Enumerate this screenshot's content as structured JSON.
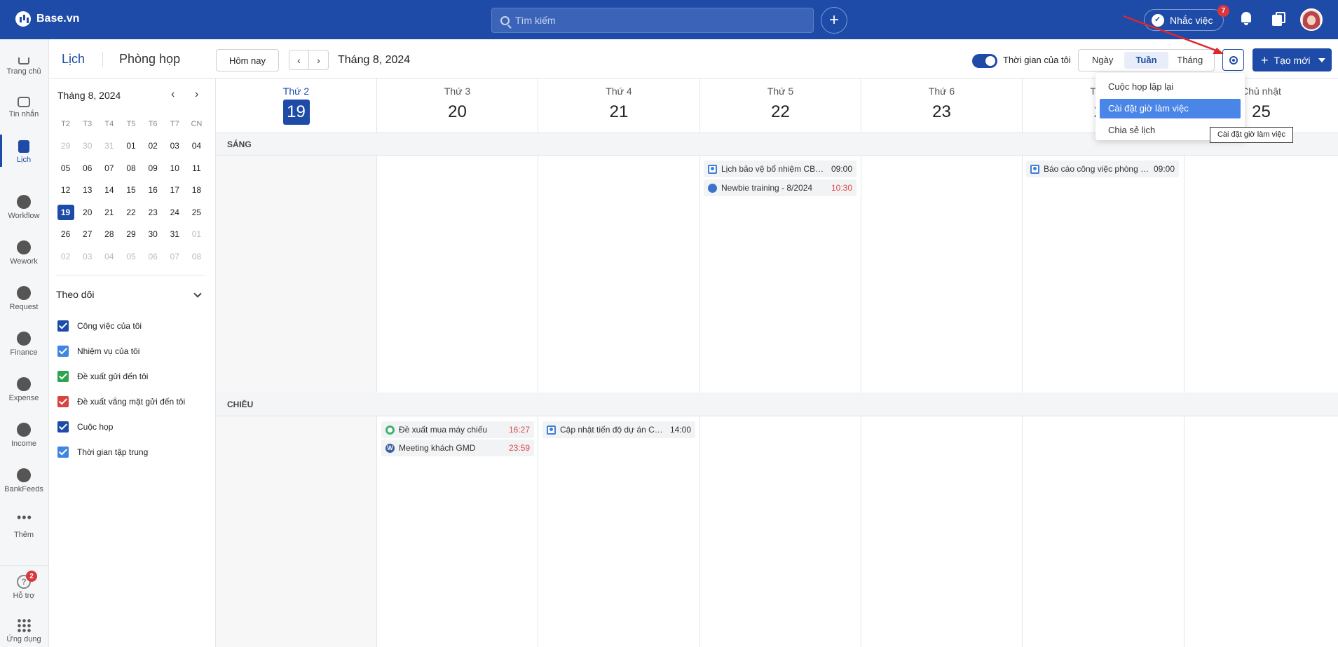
{
  "app": {
    "brand": "Base.vn",
    "search_placeholder": "Tìm kiếm",
    "remind_label": "Nhắc việc",
    "remind_badge": "7",
    "accent": "#1e4ba7"
  },
  "nav": {
    "items": [
      {
        "label": "Trang chủ",
        "icon": "home-icon"
      },
      {
        "label": "Tin nhắn",
        "icon": "chat-icon"
      },
      {
        "label": "Lịch",
        "icon": "calendar-icon"
      },
      {
        "label": "Workflow",
        "icon": "workflow-icon"
      },
      {
        "label": "Wework",
        "icon": "wework-icon"
      },
      {
        "label": "Request",
        "icon": "request-icon"
      },
      {
        "label": "Finance",
        "icon": "finance-icon"
      },
      {
        "label": "Expense",
        "icon": "expense-icon"
      },
      {
        "label": "Income",
        "icon": "income-icon"
      },
      {
        "label": "BankFeeds",
        "icon": "bankfeeds-icon"
      },
      {
        "label": "Thêm",
        "icon": "more-icon"
      }
    ],
    "support_label": "Hỗ trợ",
    "support_badge": "2",
    "apps_label": "Ứng dụng"
  },
  "header": {
    "tab_calendar": "Lịch",
    "tab_rooms": "Phòng họp",
    "today_btn": "Hôm nay",
    "prev": "‹",
    "next": "›",
    "month_title": "Tháng 8, 2024",
    "my_time_label": "Thời gian của tôi",
    "views": [
      "Ngày",
      "Tuần",
      "Tháng"
    ],
    "selected_view": "Tuần",
    "create_label": "Tạo mới"
  },
  "mini_calendar": {
    "title": "Tháng 8, 2024",
    "prev": "‹",
    "next": "›",
    "weekdays": [
      "T2",
      "T3",
      "T4",
      "T5",
      "T6",
      "T7",
      "CN"
    ],
    "weeks": [
      [
        "29",
        "30",
        "31",
        "01",
        "02",
        "03",
        "04"
      ],
      [
        "05",
        "06",
        "07",
        "08",
        "09",
        "10",
        "11"
      ],
      [
        "12",
        "13",
        "14",
        "15",
        "16",
        "17",
        "18"
      ],
      [
        "19",
        "20",
        "21",
        "22",
        "23",
        "24",
        "25"
      ],
      [
        "26",
        "27",
        "28",
        "29",
        "30",
        "31",
        "01"
      ],
      [
        "02",
        "03",
        "04",
        "05",
        "06",
        "07",
        "08"
      ]
    ],
    "today": "19"
  },
  "follow": {
    "title": "Theo dõi",
    "items": [
      {
        "label": "Công việc của tôi",
        "color": "#1e4ba7"
      },
      {
        "label": "Nhiệm vụ của tôi",
        "color": "#3f86e0"
      },
      {
        "label": "Đề xuất gửi đến tôi",
        "color": "#2ea44f"
      },
      {
        "label": "Đề xuất vắng mặt gửi đến tôi",
        "color": "#d9443f"
      },
      {
        "label": "Cuộc họp",
        "color": "#1e4ba7"
      },
      {
        "label": "Thời gian tập trung",
        "color": "#3f86e0"
      }
    ]
  },
  "week": {
    "days": [
      {
        "name": "Thứ 2",
        "date": "19"
      },
      {
        "name": "Thứ 3",
        "date": "20"
      },
      {
        "name": "Thứ 4",
        "date": "21"
      },
      {
        "name": "Thứ 5",
        "date": "22"
      },
      {
        "name": "Thứ 6",
        "date": "23"
      },
      {
        "name": "Thứ 7",
        "date": "24"
      },
      {
        "name": "Chủ nhật",
        "date": "25"
      }
    ],
    "morning_label": "SÁNG",
    "afternoon_label": "CHIỀU"
  },
  "events": {
    "e1": {
      "title": "Lịch bảo vệ bổ nhiệm CBQ...",
      "time": "09:00"
    },
    "e2": {
      "title": "Newbie training - 8/2024",
      "time": "10:30"
    },
    "e3": {
      "title": "Báo cáo công việc phòng K...",
      "time": "09:00"
    },
    "e4": {
      "title": "Đề xuất mua máy chiếu",
      "time": "16:27"
    },
    "e5": {
      "title": "Meeting khách GMD",
      "time": "23:59"
    },
    "e6": {
      "title": "Cập nhật tiến độ dự án CS...",
      "time": "14:00"
    }
  },
  "settings_menu": {
    "items": [
      "Cuộc họp lặp lại",
      "Cài đặt giờ làm việc",
      "Chia sẻ lịch"
    ],
    "tooltip": "Cài đặt giờ làm việc"
  }
}
